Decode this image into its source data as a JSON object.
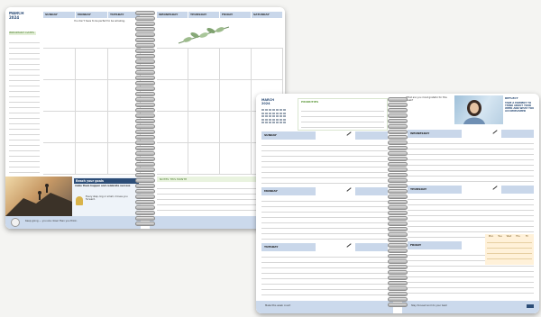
{
  "monthly_spread": {
    "month_label": "MARCH 2024",
    "days": [
      "SUNDAY",
      "MONDAY",
      "TUESDAY",
      "WEDNESDAY",
      "THURSDAY",
      "FRIDAY",
      "SATURDAY"
    ],
    "intro_note": "You don't have to be perfect to be amazing.",
    "sidebar_title": "IMPORTANT DATES",
    "notes_title": "NOTES THIS MONTH",
    "motivation_title": "Reach your goals",
    "motivation_line": "make them happen and celebrate success",
    "tip_text": "Every step, big or small, moves you forward.",
    "footer_text": "Keep going — you are closer than you think."
  },
  "weekly_spread": {
    "month_label": "MARCH 2024",
    "priorities_title": "PRIORITIES",
    "left_days": [
      "SUNDAY",
      "MONDAY",
      "TUESDAY"
    ],
    "right_days": [
      "WEDNESDAY",
      "THURSDAY",
      "FRIDAY"
    ],
    "photo_caption": "What are you most grateful for this week?",
    "side_title": "REFLECT",
    "side_text": "TAKE A MOMENT TO THINK ABOUT YOUR WEEK AND WHAT YOU ACCOMPLISHED",
    "habit_header": [
      "Mon",
      "Tue",
      "Wed",
      "Thu",
      "Fri"
    ],
    "left_footer": "Make this week count",
    "right_footer": "Stay focused and do your best",
    "page_num_left": "1",
    "page_num_right": "2"
  },
  "colors": {
    "accent_blue": "#c9d7ea",
    "dark_blue": "#2c4d77",
    "green": "#6aa84f"
  }
}
